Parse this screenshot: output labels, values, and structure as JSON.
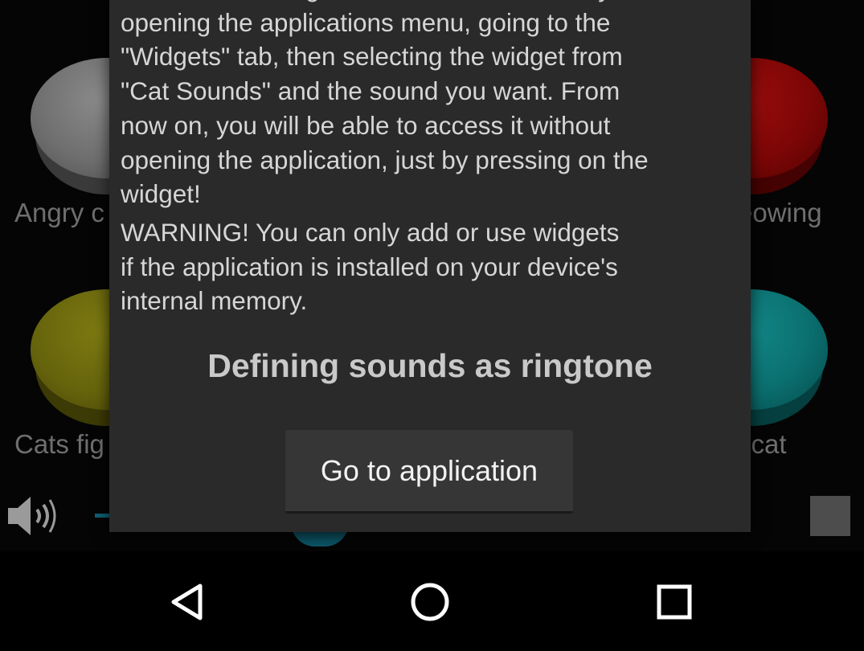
{
  "app": {
    "sounds": [
      {
        "label": "Angry c",
        "color": "#6e6e6e"
      },
      {
        "label": "eowing",
        "color": "#7d0606"
      },
      {
        "label": "Cats fig",
        "color": "#66640c"
      },
      {
        "label": "l cat",
        "color": "#0b6f6f"
      }
    ]
  },
  "dialog": {
    "widgets_text": "You can add widgets to the home screen by\nopening the applications menu, going to the\n\"Widgets\" tab, then selecting the widget from\n\"Cat Sounds\" and the sound you want. From\nnow on, you will be able to access it without\nopening the application, just by pressing on the\nwidget!",
    "warning_text": "WARNING! You can only add or use widgets\nif the application is installed on your device's\ninternal memory.",
    "section_heading": "Defining sounds as ringtone",
    "go_button_label": "Go to application"
  },
  "nav": {
    "back_icon": "triangle-back-icon",
    "home_icon": "circle-home-icon",
    "recent_icon": "square-recent-apps-icon"
  }
}
